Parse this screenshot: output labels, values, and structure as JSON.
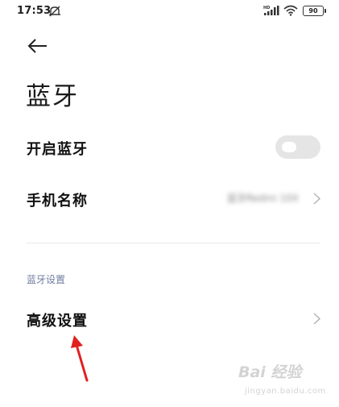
{
  "status_bar": {
    "time": "17:53",
    "battery_level": "90",
    "icons": [
      "notifications-muted-icon",
      "hd-signal-icon",
      "wifi-icon",
      "battery-icon"
    ]
  },
  "header": {
    "back_icon": "back-arrow-icon",
    "title": "蓝牙"
  },
  "settings": {
    "bluetooth_toggle": {
      "label": "开启蓝牙",
      "enabled": false
    },
    "device_name": {
      "label": "手机名称",
      "value": "蓝牙Redmi 10X"
    },
    "section_label": "蓝牙设置",
    "advanced": {
      "label": "高级设置"
    }
  },
  "annotation": {
    "icon": "red-arrow-icon",
    "color": "#e02020"
  },
  "watermark": {
    "logo": "Bai 经验",
    "sub": "jingyan.baidu.com"
  },
  "colors": {
    "accent_label": "#6e7c9e",
    "toggle_off": "#e5e5e5"
  }
}
